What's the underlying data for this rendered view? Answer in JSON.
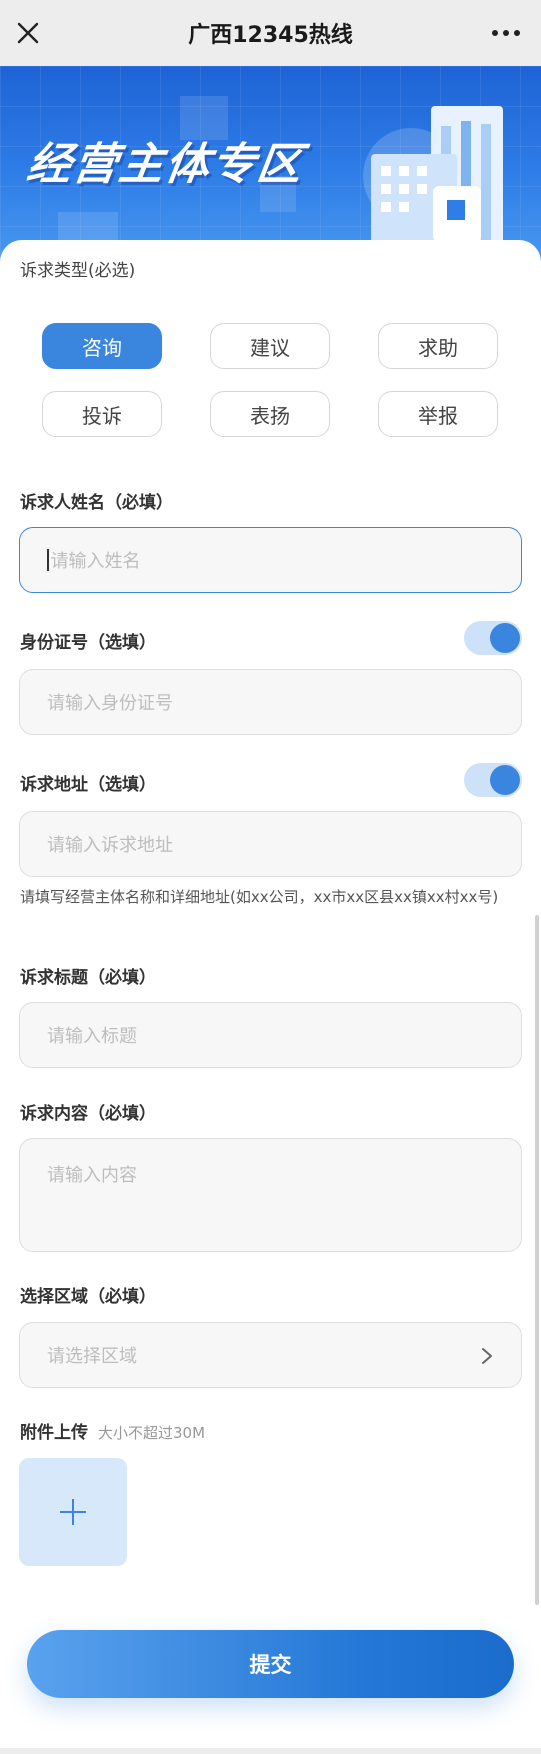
{
  "header": {
    "title": "广西12345热线"
  },
  "banner": {
    "title": "经营主体专区"
  },
  "form": {
    "type_label": "诉求类型(必选)",
    "types": [
      "咨询",
      "建议",
      "求助",
      "投诉",
      "表扬",
      "举报"
    ],
    "selected_type": "咨询",
    "name_label": "诉求人姓名（必填）",
    "name_placeholder": "请输入姓名",
    "id_label": "身份证号（选填）",
    "id_placeholder": "请输入身份证号",
    "address_label": "诉求地址（选填）",
    "address_placeholder": "请输入诉求地址",
    "address_hint": "请填写经营主体名称和详细地址(如xx公司，xx市xx区县xx镇xx村xx号)",
    "subject_label": "诉求标题（必填）",
    "subject_placeholder": "请输入标题",
    "content_label": "诉求内容（必填）",
    "content_placeholder": "请输入内容",
    "region_label": "选择区域（必填）",
    "region_placeholder": "请选择区域",
    "attachment_label": "附件上传",
    "attachment_hint": "大小不超过30M",
    "submit_label": "提交"
  },
  "toggles": {
    "id_enabled": true,
    "address_enabled": true
  },
  "colors": {
    "accent": "#3a86de",
    "banner": "#2f7ee8"
  }
}
